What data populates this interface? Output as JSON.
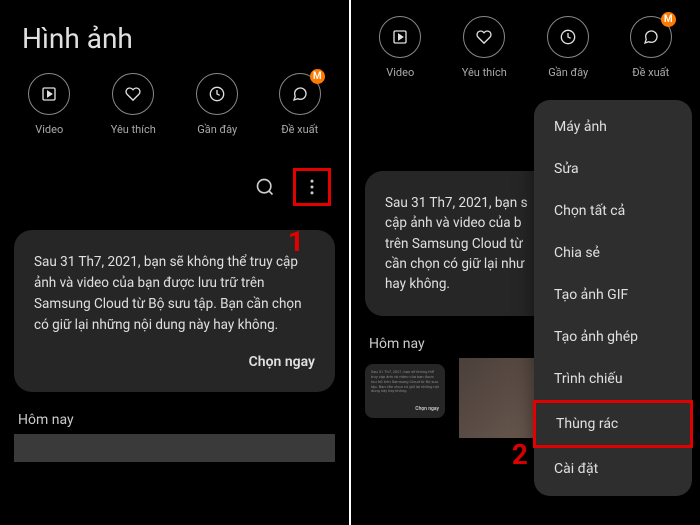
{
  "panel1": {
    "title": "Hình ảnh",
    "tabs": [
      {
        "label": "Video",
        "badge": null
      },
      {
        "label": "Yêu thích",
        "badge": null
      },
      {
        "label": "Gần đây",
        "badge": null
      },
      {
        "label": "Đề xuất",
        "badge": "M"
      }
    ],
    "card_text": "Sau 31 Th7, 2021, bạn sẽ không thể truy cập ảnh và video của bạn được lưu trữ trên Samsung Cloud từ Bộ sưu tập. Bạn cần chọn có giữ lại những nội dung này hay không.",
    "card_btn": "Chọn ngay",
    "section": "Hôm nay",
    "step": "1"
  },
  "panel2": {
    "tabs": [
      {
        "label": "Video",
        "badge": null
      },
      {
        "label": "Yêu thích",
        "badge": null
      },
      {
        "label": "Gần đây",
        "badge": null
      },
      {
        "label": "Đề xuất",
        "badge": "M"
      }
    ],
    "card_text": "Sau 31 Th7, 2021, bạn s\ncập ảnh và video của b\ntrên Samsung Cloud từ\ncần chọn có giữ lại như\nhay không.",
    "section": "Hôm nay",
    "step": "2",
    "menu": [
      "Máy ảnh",
      "Sửa",
      "Chọn tất cả",
      "Chia sẻ",
      "Tạo ảnh GIF",
      "Tạo ảnh ghép",
      "Trình chiếu",
      "Thùng rác",
      "Cài đặt"
    ],
    "menu_highlighted_index": 7
  }
}
